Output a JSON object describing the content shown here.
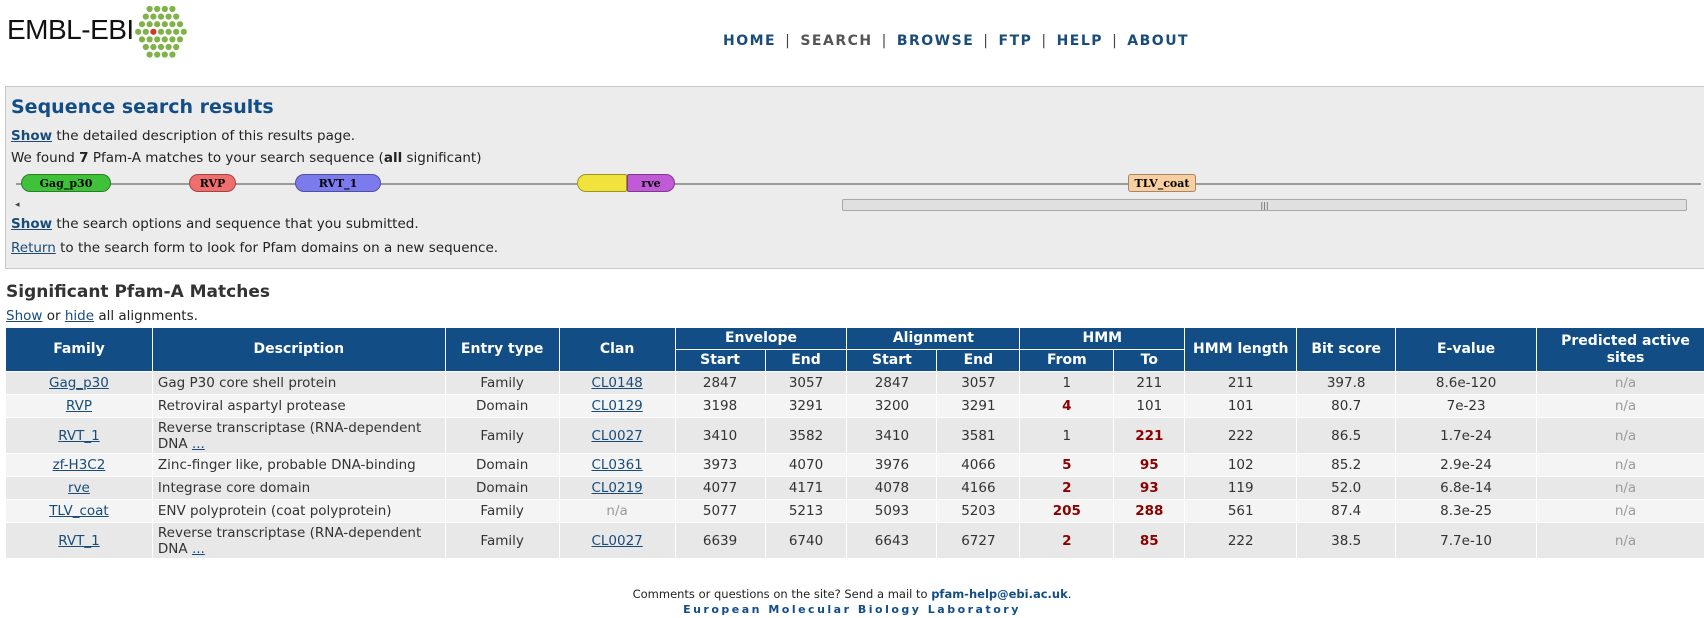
{
  "header": {
    "logo_text": "EMBL-EBI",
    "nav": [
      {
        "label": "HOME",
        "current": false
      },
      {
        "label": "SEARCH",
        "current": true
      },
      {
        "label": "BROWSE",
        "current": false
      },
      {
        "label": "FTP",
        "current": false
      },
      {
        "label": "HELP",
        "current": false
      },
      {
        "label": "ABOUT",
        "current": false
      }
    ],
    "nav_separator": "|"
  },
  "results_panel": {
    "title": "Sequence search results",
    "show_description": {
      "link": "Show",
      "text": " the detailed description of this results page."
    },
    "found_line": {
      "prefix": "We found ",
      "count": "7",
      "middle": " Pfam-A matches to your search sequence (",
      "all": "all",
      "suffix": " significant)"
    },
    "domain_graphic": [
      {
        "label": "Gag_p30",
        "color": "#3fc13a"
      },
      {
        "label": "RVP",
        "color": "#f06e6e"
      },
      {
        "label": "RVT_1",
        "color": "#7b7bee"
      },
      {
        "label": "",
        "color": "#f2e33c"
      },
      {
        "label": "rve",
        "color": "#c15ad6"
      },
      {
        "label": "TLV_coat",
        "color": "#f9cfa2"
      }
    ],
    "show_options": {
      "link": "Show",
      "text": " the search options and sequence that you submitted."
    },
    "return_line": {
      "link": "Return",
      "text": " to the search form to look for Pfam domains on a new sequence."
    }
  },
  "matches": {
    "title": "Significant Pfam-A Matches",
    "show": "Show",
    "or": " or ",
    "hide": "hide",
    "all_alignments": " all alignments.",
    "headers": {
      "family": "Family",
      "description": "Description",
      "entry_type": "Entry type",
      "clan": "Clan",
      "envelope": "Envelope",
      "alignment": "Alignment",
      "hmm": "HMM",
      "start": "Start",
      "end": "End",
      "from": "From",
      "to": "To",
      "hmm_length": "HMM length",
      "bit_score": "Bit score",
      "evalue": "E-value",
      "predicted_active_sites": "Predicted active sites"
    },
    "rows": [
      {
        "family": "Gag_p30",
        "description": "Gag P30 core shell protein",
        "desc_more": "",
        "entry_type": "Family",
        "clan": "CL0148",
        "env_start": "2847",
        "env_end": "3057",
        "ali_start": "2847",
        "ali_end": "3057",
        "hmm_from": "1",
        "hmm_to": "211",
        "hmm_length": "211",
        "bit_score": "397.8",
        "evalue": "8.6e-120",
        "active_sites": "n/a"
      },
      {
        "family": "RVP",
        "description": "Retroviral aspartyl protease",
        "desc_more": "",
        "entry_type": "Domain",
        "clan": "CL0129",
        "env_start": "3198",
        "env_end": "3291",
        "ali_start": "3200",
        "ali_end": "3291",
        "hmm_from": "4",
        "hmm_to": "101",
        "hmm_length": "101",
        "bit_score": "80.7",
        "evalue": "7e-23",
        "active_sites": "n/a"
      },
      {
        "family": "RVT_1",
        "description": "Reverse transcriptase (RNA-dependent DNA ",
        "desc_more": "...",
        "entry_type": "Family",
        "clan": "CL0027",
        "env_start": "3410",
        "env_end": "3582",
        "ali_start": "3410",
        "ali_end": "3581",
        "hmm_from": "1",
        "hmm_to": "221",
        "hmm_length": "222",
        "bit_score": "86.5",
        "evalue": "1.7e-24",
        "active_sites": "n/a"
      },
      {
        "family": "zf-H3C2",
        "description": "Zinc-finger like, probable DNA-binding",
        "desc_more": "",
        "entry_type": "Domain",
        "clan": "CL0361",
        "env_start": "3973",
        "env_end": "4070",
        "ali_start": "3976",
        "ali_end": "4066",
        "hmm_from": "5",
        "hmm_to": "95",
        "hmm_length": "102",
        "bit_score": "85.2",
        "evalue": "2.9e-24",
        "active_sites": "n/a"
      },
      {
        "family": "rve",
        "description": "Integrase core domain",
        "desc_more": "",
        "entry_type": "Domain",
        "clan": "CL0219",
        "env_start": "4077",
        "env_end": "4171",
        "ali_start": "4078",
        "ali_end": "4166",
        "hmm_from": "2",
        "hmm_to": "93",
        "hmm_length": "119",
        "bit_score": "52.0",
        "evalue": "6.8e-14",
        "active_sites": "n/a"
      },
      {
        "family": "TLV_coat",
        "description": "ENV polyprotein (coat polyprotein)",
        "desc_more": "",
        "entry_type": "Family",
        "clan": "n/a",
        "env_start": "5077",
        "env_end": "5213",
        "ali_start": "5093",
        "ali_end": "5203",
        "hmm_from": "205",
        "hmm_to": "288",
        "hmm_length": "561",
        "bit_score": "87.4",
        "evalue": "8.3e-25",
        "active_sites": "n/a"
      },
      {
        "family": "RVT_1",
        "description": "Reverse transcriptase (RNA-dependent DNA ",
        "desc_more": "...",
        "entry_type": "Family",
        "clan": "CL0027",
        "env_start": "6639",
        "env_end": "6740",
        "ali_start": "6643",
        "ali_end": "6727",
        "hmm_from": "2",
        "hmm_to": "85",
        "hmm_length": "222",
        "bit_score": "38.5",
        "evalue": "7.7e-10",
        "active_sites": "n/a"
      }
    ]
  },
  "footer": {
    "comments": "Comments or questions on the site? Send a mail to ",
    "email": "pfam-help@ebi.ac.uk",
    "period": ".",
    "lab": "European Molecular Biology Laboratory"
  }
}
